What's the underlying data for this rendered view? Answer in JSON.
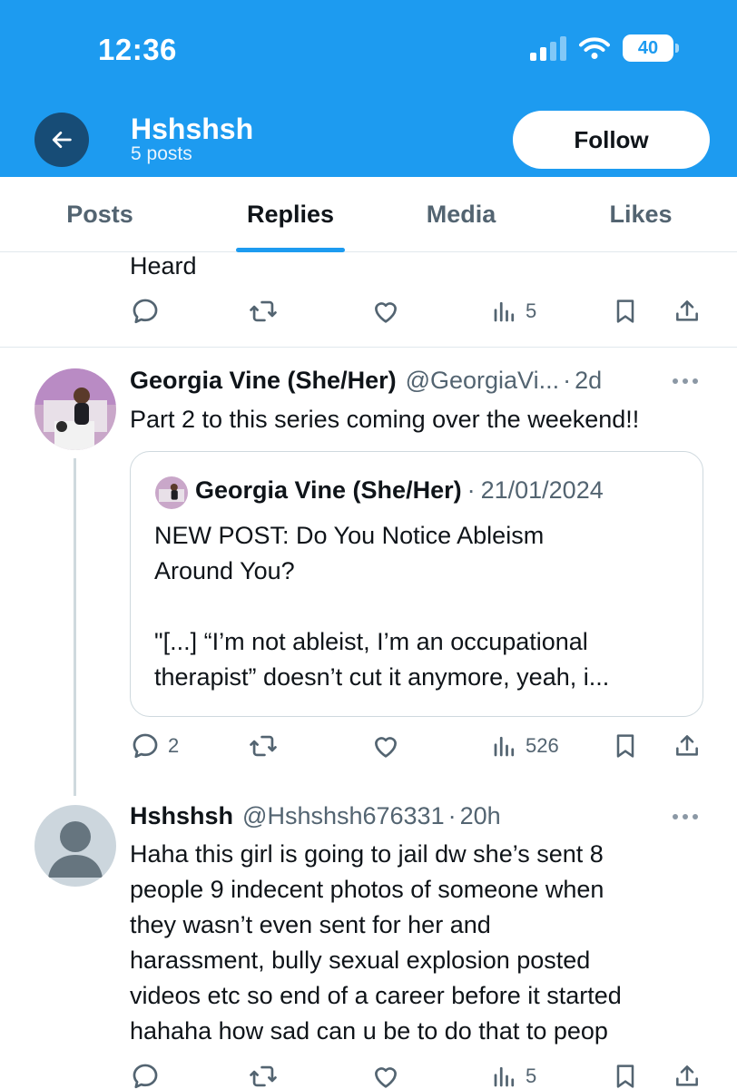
{
  "status_bar": {
    "time": "12:36",
    "battery": "40"
  },
  "header": {
    "name": "Hshshsh",
    "post_count": "5 posts",
    "follow_label": "Follow"
  },
  "tabs": [
    {
      "label": "Posts"
    },
    {
      "label": "Replies",
      "active": true
    },
    {
      "label": "Media"
    },
    {
      "label": "Likes"
    }
  ],
  "posts": [
    {
      "text_lines": [
        "Heard"
      ],
      "actions": {
        "replies": "",
        "reposts": "",
        "likes": "",
        "views": "5"
      }
    },
    {
      "author_name": "Georgia Vine (She/Her)",
      "handle": "@GeorgiaVi...",
      "time": "2d",
      "text_lines": [
        "Part 2 to this series coming over the weekend!!"
      ],
      "quote": {
        "author_name": "Georgia Vine (She/Her)",
        "date": "21/01/2024",
        "text_lines": [
          "NEW POST: Do You Notice Ableism",
          "Around You?",
          "",
          "\"[...] “I’m not ableist, I’m an occupational",
          "therapist” doesn’t cut it anymore, yeah, i..."
        ]
      },
      "actions": {
        "replies": "2",
        "reposts": "",
        "likes": "",
        "views": "526"
      }
    },
    {
      "author_name": "Hshshsh",
      "handle": "@Hshshsh676331",
      "time": "20h",
      "text_lines": [
        "Haha this girl is going to jail dw she’s sent 8",
        "people 9 indecent photos of someone when",
        "they wasn’t even sent for her and",
        "harassment, bully sexual explosion posted",
        "videos etc so end of a career before it started",
        "hahaha how sad can u be to do that to peop"
      ],
      "actions": {
        "replies": "",
        "reposts": "",
        "likes": "",
        "views": "5"
      }
    }
  ],
  "colors": {
    "brand": "#1d9bf0",
    "back_button": "#174c76",
    "secondary_text": "#536471"
  },
  "icons": [
    "back-arrow-icon",
    "reply-icon",
    "repost-icon",
    "like-icon",
    "views-icon",
    "bookmark-icon",
    "share-icon",
    "more-icon"
  ]
}
